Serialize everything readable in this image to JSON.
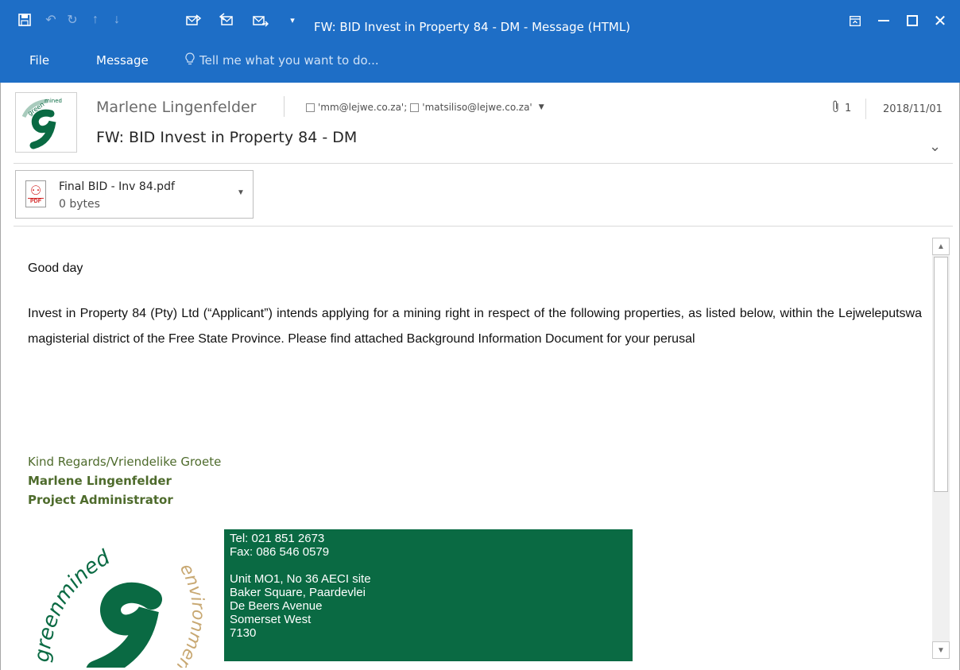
{
  "window": {
    "title": "FW: BID Invest in Property 84 - DM - Message (HTML)",
    "colors": {
      "titlebar": "#1e6ec6",
      "signature_green": "#4e6b2c",
      "contact_bg": "#0a6a43"
    }
  },
  "ribbon": {
    "tabs": [
      "File",
      "Message"
    ],
    "tell_me": "Tell me what you want to do..."
  },
  "message": {
    "sender": "Marlene Lingenfelder",
    "recipients": [
      "'mm@lejwe.co.za';",
      "'matsiliso@lejwe.co.za'"
    ],
    "subject": "FW: BID Invest in Property 84 - DM",
    "attachment_count": "1",
    "date": "2018/11/01",
    "attachment": {
      "name": "Final BID - Inv 84.pdf",
      "size": "0 bytes",
      "type_label": "PDF"
    }
  },
  "body": {
    "greeting": "Good day",
    "paragraph": "Invest in Property 84 (Pty) Ltd (“Applicant”) intends applying for a mining right in respect of the following properties, as listed below, within the Lejweleputswa magisterial district of the Free State Province. Please find attached Background Information Document for your perusal",
    "signature": {
      "closing": "Kind Regards/Vriendelike Groete",
      "name": "Marlene Lingenfelder",
      "title": "Project Administrator"
    },
    "contact": {
      "tel": "Tel: 021 851 2673",
      "fax": "Fax: 086 546 0579",
      "address_lines": [
        "Unit MO1, No 36 AECI site",
        "Baker Square, Paardevlei",
        "De Beers Avenue",
        "Somerset West",
        "7130"
      ]
    },
    "logo_text": {
      "top": "greenmined",
      "side": "environmental"
    }
  }
}
